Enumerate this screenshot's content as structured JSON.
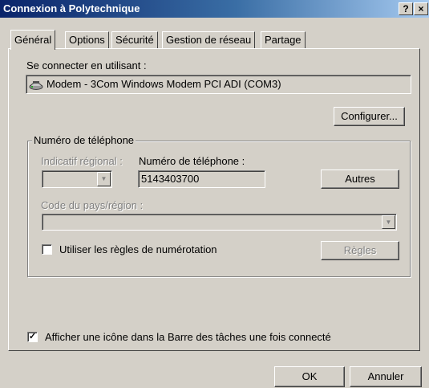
{
  "window": {
    "title": "Connexion à Polytechnique",
    "help_glyph": "?",
    "close_glyph": "×"
  },
  "tabs": [
    "Général",
    "Options",
    "Sécurité",
    "Gestion de réseau",
    "Partage"
  ],
  "connect_using": {
    "label": "Se connecter en utilisant :",
    "device": "Modem - 3Com Windows Modem PCI ADI (COM3)",
    "device_icon": "modem-icon",
    "configure_button": "Configurer..."
  },
  "phone": {
    "group_title": "Numéro de téléphone",
    "area_code_label": "Indicatif régional :",
    "number_label": "Numéro de téléphone :",
    "number_value": "5143403700",
    "others_button": "Autres",
    "country_label": "Code du pays/région :",
    "dialing_rules_label": "Utiliser les règles de numérotation",
    "dialing_rules_checked": false,
    "rules_button": "Règles"
  },
  "taskbar_icon": {
    "label": "Afficher une icône dans la Barre des tâches une fois connecté",
    "checked": true
  },
  "footer": {
    "ok": "OK",
    "cancel": "Annuler"
  },
  "colors": {
    "title_bar": "#0a246a",
    "dialog_face": "#d4d0c8"
  }
}
